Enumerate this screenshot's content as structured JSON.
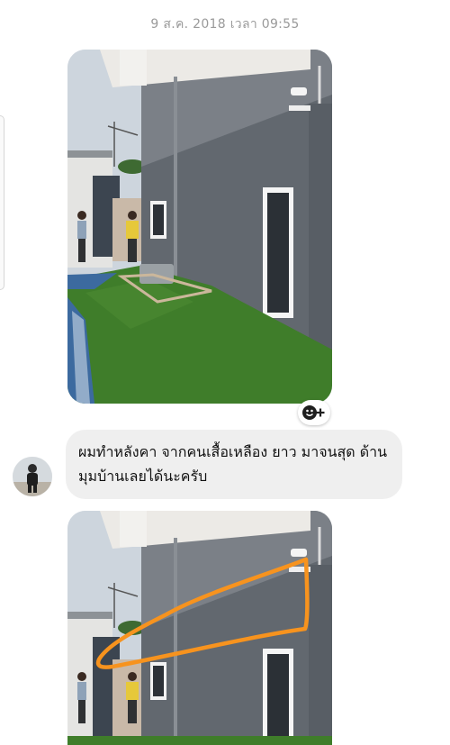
{
  "conversation": {
    "timestamp": "9 ส.ค. 2018 เวลา 09:55"
  },
  "messages": [
    {
      "type": "photo",
      "subject": "house-side-grass-yard"
    },
    {
      "type": "text",
      "text": "ผมทำหลังคา จากคนเสื้อเหลือง ยาว มาจนสุด ด้าน มุมบ้านเลยได้นะครับ"
    },
    {
      "type": "photo",
      "subject": "house-side-with-orange-outline"
    }
  ],
  "icons": {
    "react": "smiley-plus-icon",
    "annotation_color": "#f7931e"
  },
  "colors": {
    "bubble_bg": "#efefef",
    "timestamp": "#9a9a9a",
    "wall_gray": "#5f656d",
    "grass": "#3f7d2a"
  }
}
